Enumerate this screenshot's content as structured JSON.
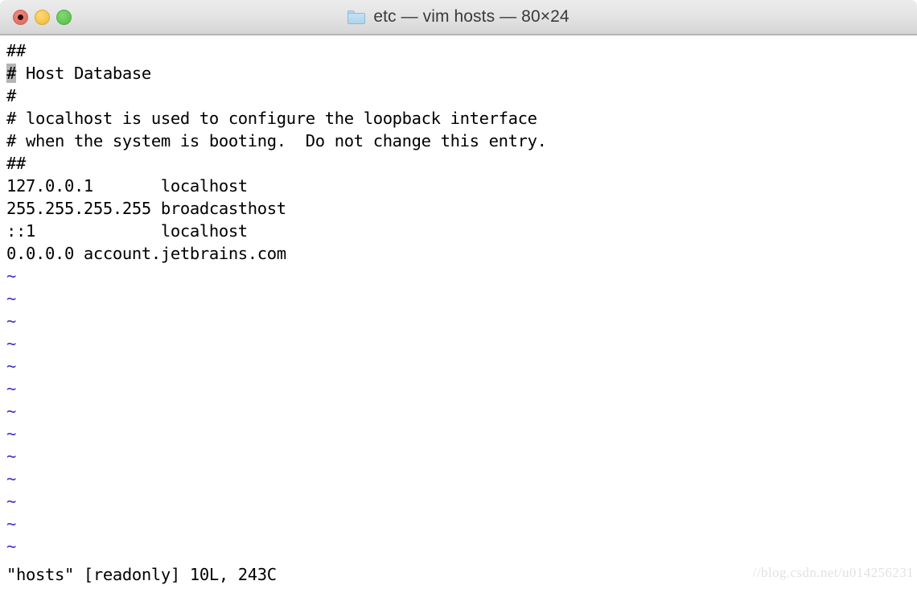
{
  "window": {
    "title": "etc — vim hosts — 80×24",
    "folder_icon": "folder-icon",
    "controls": {
      "close_label": "close",
      "minimize_label": "minimize",
      "maximize_label": "maximize"
    }
  },
  "terminal": {
    "app": "vim",
    "columns": 80,
    "rows": 24,
    "background": "#ffffff",
    "foreground": "#000000",
    "tilde_color": "#3a30c8",
    "cursor_color": "#b4b4b4",
    "cursor": {
      "line": 2,
      "column": 1,
      "char": "#"
    },
    "lines": [
      {
        "text": "##"
      },
      {
        "prefix": "",
        "cursor_char": "#",
        "suffix": " Host Database"
      },
      {
        "text": "#"
      },
      {
        "text": "# localhost is used to configure the loopback interface"
      },
      {
        "text": "# when the system is booting.  Do not change this entry."
      },
      {
        "text": "##"
      },
      {
        "text": "127.0.0.1       localhost"
      },
      {
        "text": "255.255.255.255 broadcasthost"
      },
      {
        "text": "::1             localhost"
      },
      {
        "text": "0.0.0.0 account.jetbrains.com"
      }
    ],
    "empty_markers": [
      "~",
      "~",
      "~",
      "~",
      "~",
      "~",
      "~",
      "~",
      "~",
      "~",
      "~",
      "~",
      "~"
    ],
    "statusline": "\"hosts\" [readonly] 10L, 243C"
  },
  "watermark": {
    "text": "//blog.csdn.net/u014256231"
  }
}
